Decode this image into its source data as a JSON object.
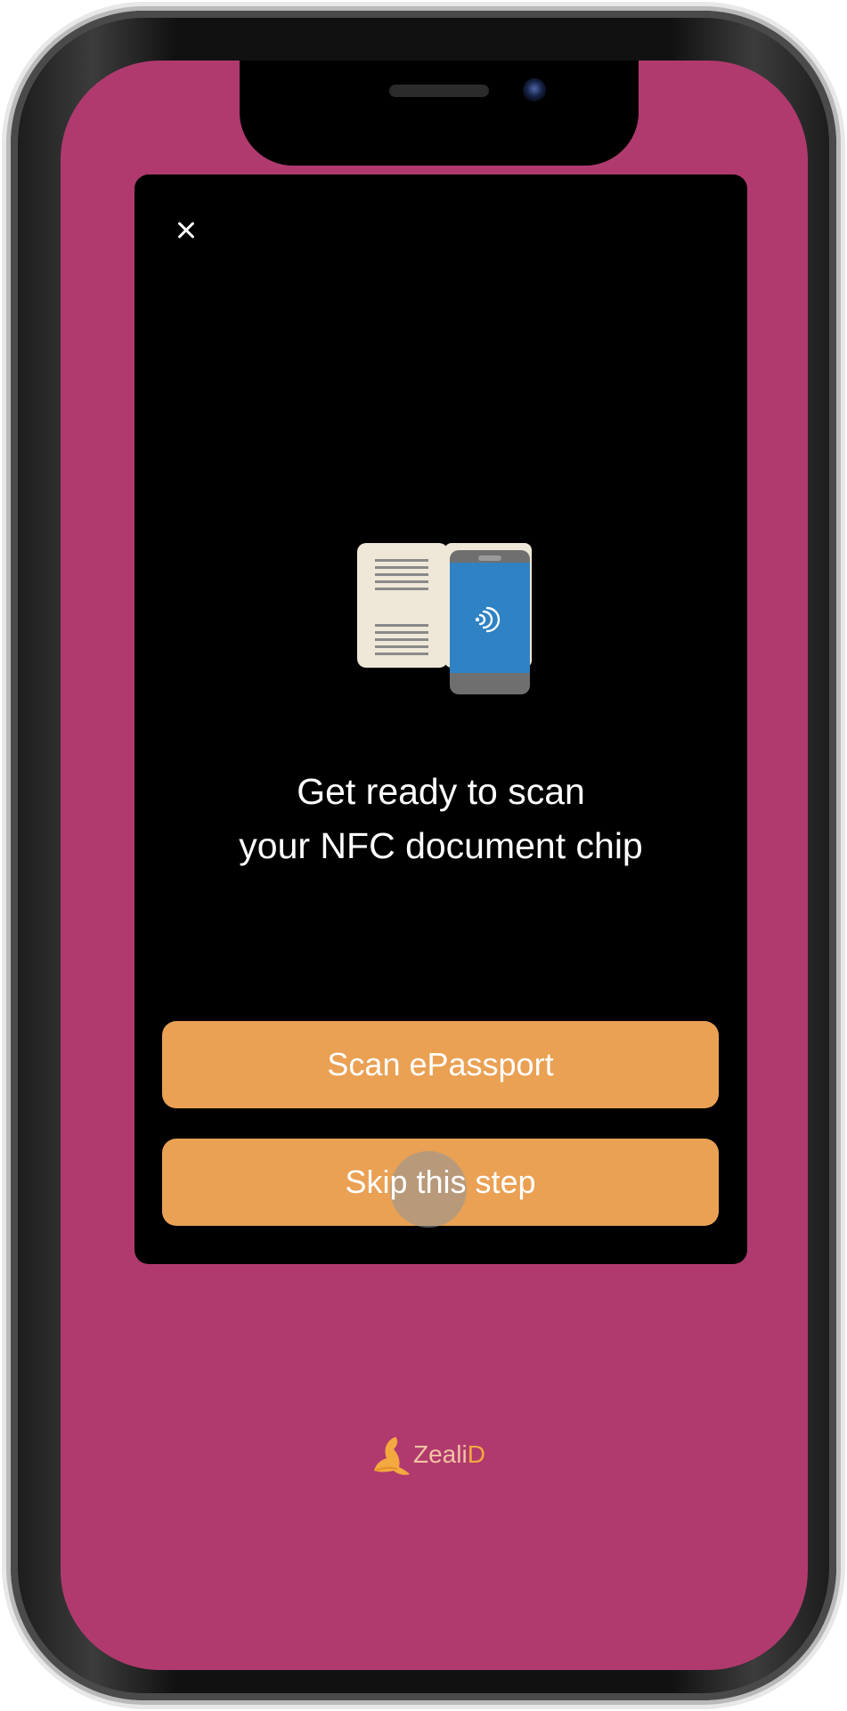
{
  "screen": {
    "title_line1": "Get ready to scan",
    "title_line2": "your NFC document chip"
  },
  "actions": {
    "scan_label": "Scan ePassport",
    "skip_label": "Skip this step"
  },
  "brand": {
    "name_part1": "Zeali",
    "name_part2": "D"
  },
  "icons": {
    "close": "close-icon",
    "illustration": "passport-phone-nfc-icon",
    "logo": "zealid-logo-icon"
  },
  "colors": {
    "background": "#b03a6e",
    "card": "#000000",
    "button": "#eaa154",
    "phone_screen": "#2f82c4"
  }
}
